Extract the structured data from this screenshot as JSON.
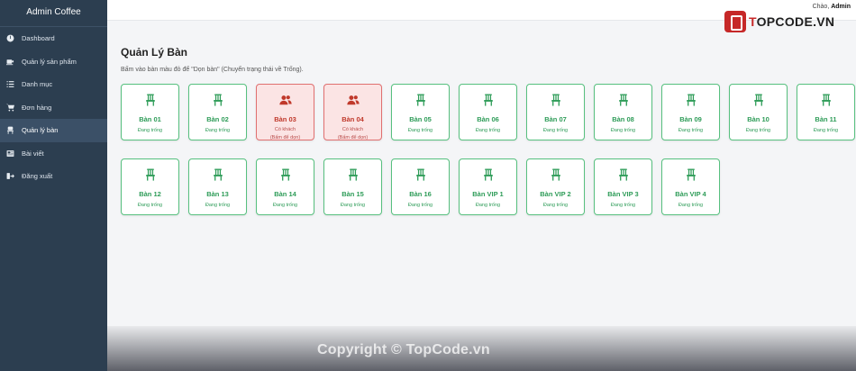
{
  "app": {
    "title": "Admin Coffee"
  },
  "sidebar": {
    "items": [
      {
        "label": "Dashboard",
        "icon": "gauge-icon",
        "active": false
      },
      {
        "label": "Quản lý sản phẩm",
        "icon": "coffee-cup-icon",
        "active": false
      },
      {
        "label": "Danh mục",
        "icon": "list-icon",
        "active": false
      },
      {
        "label": "Đơn hàng",
        "icon": "cart-icon",
        "active": false
      },
      {
        "label": "Quản lý bàn",
        "icon": "chair-icon",
        "active": true
      },
      {
        "label": "Bài viết",
        "icon": "newspaper-icon",
        "active": false
      },
      {
        "label": "Đăng xuất",
        "icon": "logout-icon",
        "active": false
      }
    ]
  },
  "header": {
    "greeting_prefix": "Chào,",
    "user": "Admin"
  },
  "logo": {
    "brand_accent": "T",
    "brand_rest": "OPCODE.VN"
  },
  "page": {
    "title": "Quản Lý Bàn",
    "subtitle": "Bấm vào bàn màu đỏ để \"Dọn bàn\" (Chuyển trạng thái về Trống)."
  },
  "tables": [
    {
      "name": "Bàn 01",
      "status": "Đang trống",
      "busy": false
    },
    {
      "name": "Bàn 02",
      "status": "Đang trống",
      "busy": false
    },
    {
      "name": "Bàn 03",
      "status": "Có khách",
      "hint": "(Bấm để dọn)",
      "busy": true
    },
    {
      "name": "Bàn 04",
      "status": "Có khách",
      "hint": "(Bấm để dọn)",
      "busy": true
    },
    {
      "name": "Bàn 05",
      "status": "Đang trống",
      "busy": false
    },
    {
      "name": "Bàn 06",
      "status": "Đang trống",
      "busy": false
    },
    {
      "name": "Bàn 07",
      "status": "Đang trống",
      "busy": false
    },
    {
      "name": "Bàn 08",
      "status": "Đang trống",
      "busy": false
    },
    {
      "name": "Bàn 09",
      "status": "Đang trống",
      "busy": false
    },
    {
      "name": "Bàn 10",
      "status": "Đang trống",
      "busy": false
    },
    {
      "name": "Bàn 11",
      "status": "Đang trống",
      "busy": false
    },
    {
      "name": "Bàn 12",
      "status": "Đang trống",
      "busy": false
    },
    {
      "name": "Bàn 13",
      "status": "Đang trống",
      "busy": false
    },
    {
      "name": "Bàn 14",
      "status": "Đang trống",
      "busy": false
    },
    {
      "name": "Bàn 15",
      "status": "Đang trống",
      "busy": false
    },
    {
      "name": "Bàn 16",
      "status": "Đang trống",
      "busy": false
    },
    {
      "name": "Bàn VIP 1",
      "status": "Đang trống",
      "busy": false
    },
    {
      "name": "Bàn VIP 2",
      "status": "Đang trống",
      "busy": false
    },
    {
      "name": "Bàn VIP 3",
      "status": "Đang trống",
      "busy": false
    },
    {
      "name": "Bàn VIP 4",
      "status": "Đang trống",
      "busy": false
    }
  ],
  "watermark": "Copyright © TopCode.vn",
  "colors": {
    "free": "#2e9c58",
    "busy": "#c0392b",
    "sidebar": "#2c3e50"
  }
}
